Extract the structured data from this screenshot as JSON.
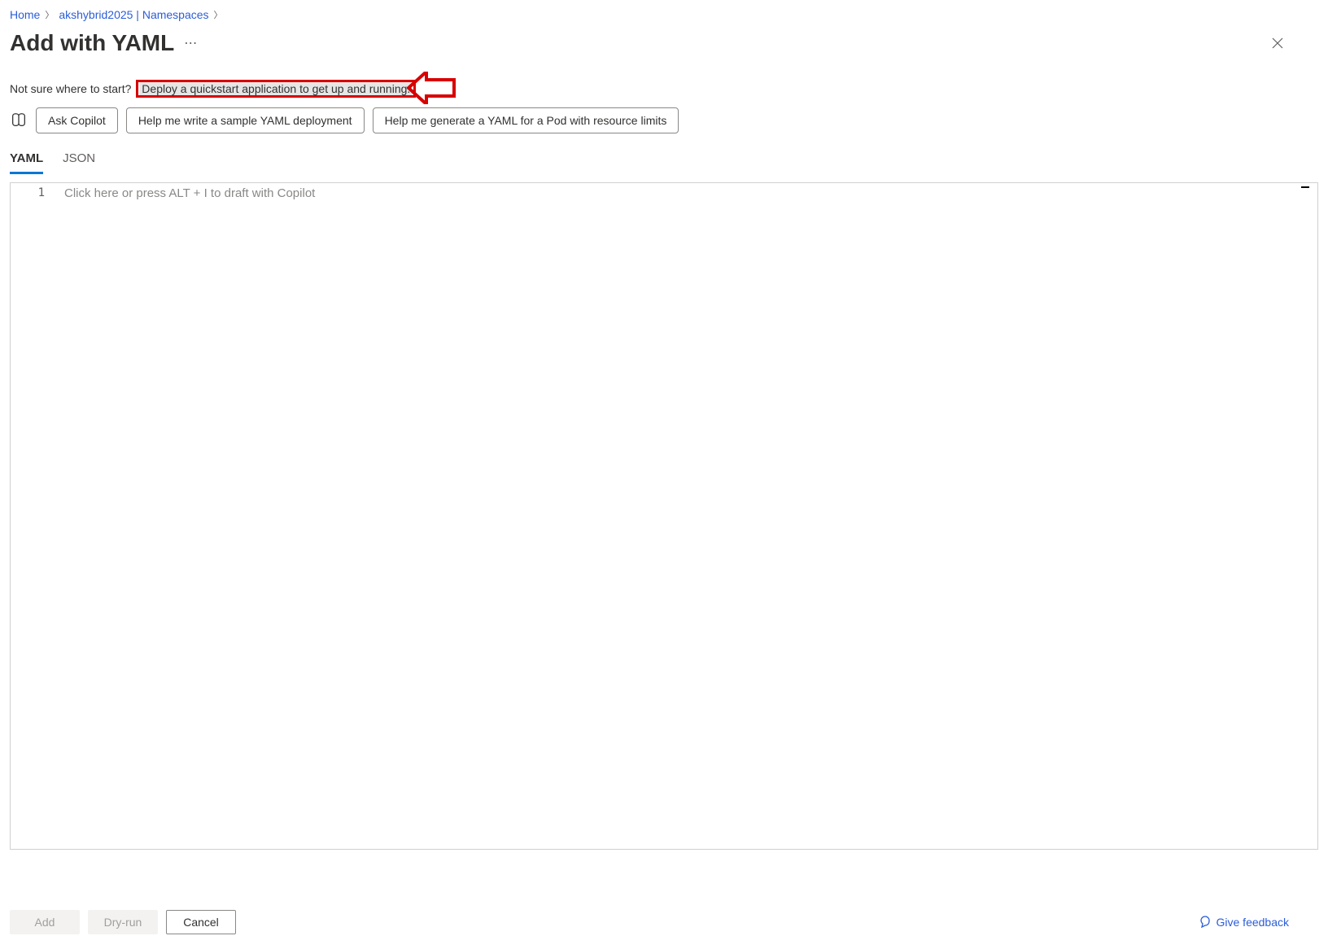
{
  "breadcrumb": {
    "home": "Home",
    "item2": "akshybrid2025 | Namespaces"
  },
  "title": "Add with YAML",
  "helper": {
    "prefix": "Not sure where to start?",
    "link": "Deploy a quickstart application to get up and running."
  },
  "copilot": {
    "ask": "Ask Copilot",
    "chip1": "Help me write a sample YAML deployment",
    "chip2": "Help me generate a YAML for a Pod with resource limits"
  },
  "tabs": {
    "yaml": "YAML",
    "json": "JSON"
  },
  "editor": {
    "line1_number": "1",
    "placeholder": "Click here or press ALT + I to draft with Copilot"
  },
  "footer": {
    "add": "Add",
    "dryrun": "Dry-run",
    "cancel": "Cancel",
    "feedback": "Give feedback"
  }
}
